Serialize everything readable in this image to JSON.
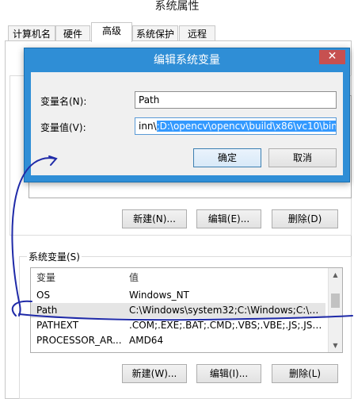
{
  "background_window": {
    "title": "系统属性",
    "tabs": [
      "计算机名",
      "硬件",
      "高级",
      "系统保护",
      "远程"
    ],
    "active_tab_index": 2,
    "user_vars": {
      "buttons": {
        "new": "新建(N)...",
        "edit": "编辑(E)...",
        "delete": "删除(D)"
      }
    },
    "system_vars": {
      "group_label": "系统变量(S)",
      "columns": [
        "变量",
        "值"
      ],
      "rows": [
        {
          "name": "OS",
          "value": "Windows_NT"
        },
        {
          "name": "Path",
          "value": "C:\\Windows\\system32;C:\\Windows;C:\\Wi..."
        },
        {
          "name": "PATHEXT",
          "value": ".COM;.EXE;.BAT;.CMD;.VBS;.VBE;.JS;.JSE;..."
        },
        {
          "name": "PROCESSOR_AR...",
          "value": "AMD64"
        }
      ],
      "selected_row_index": 1,
      "buttons": {
        "new": "新建(W)...",
        "edit": "编辑(I)...",
        "delete": "删除(L)"
      }
    }
  },
  "dialog": {
    "title": "编辑系统变量",
    "close_glyph": "✕",
    "name_label": "变量名(N):",
    "name_value": "Path",
    "value_label": "变量值(V):",
    "value_prefix": "inn\\",
    "value_selected": ";D:\\opencv\\opencv\\build\\x86\\vc10\\bin",
    "ok": "确定",
    "cancel": "取消"
  },
  "colors": {
    "dialog_frame": "#2f8ed6",
    "close_button": "#c75050",
    "selection": "#3399ff",
    "ink": "#1f2aa8"
  }
}
